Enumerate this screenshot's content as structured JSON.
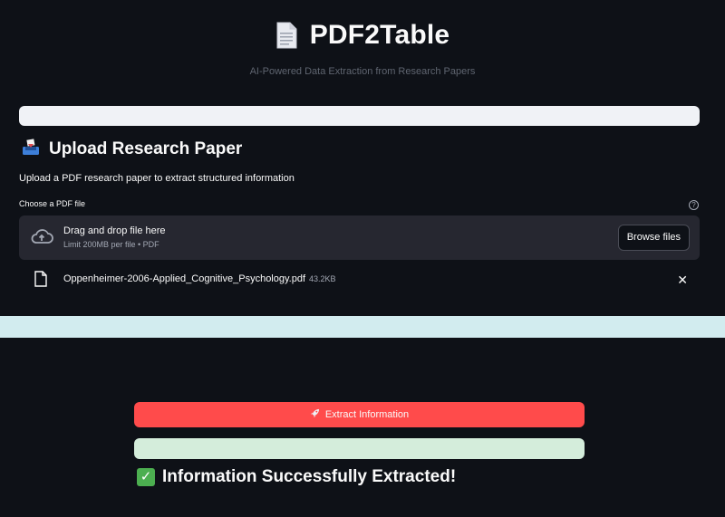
{
  "header": {
    "title": "PDF2Table",
    "subtitle": "AI-Powered Data Extraction from Research Papers",
    "icon": "document-icon"
  },
  "upload_section": {
    "heading": "Upload Research Paper",
    "heading_icon": "inbox-tray-icon",
    "description": "Upload a PDF research paper to extract structured information",
    "uploader_label": "Choose a PDF file",
    "dropzone": {
      "title": "Drag and drop file here",
      "limit": "Limit 200MB per file • PDF",
      "browse_label": "Browse files"
    },
    "uploaded_file": {
      "name": "Oppenheimer-2006-Applied_Cognitive_Psychology.pdf",
      "size": "43.2KB"
    }
  },
  "actions": {
    "extract_label": "Extract Information",
    "extract_icon": "rocket-icon"
  },
  "result": {
    "success_text": "Information Successfully Extracted!",
    "success_icon": "check-mark-icon"
  },
  "colors": {
    "background": "#0e1117",
    "accent": "#ff4b4b",
    "dropzone": "#262730",
    "info": "#d2ecef",
    "success": "#d4eddb"
  }
}
